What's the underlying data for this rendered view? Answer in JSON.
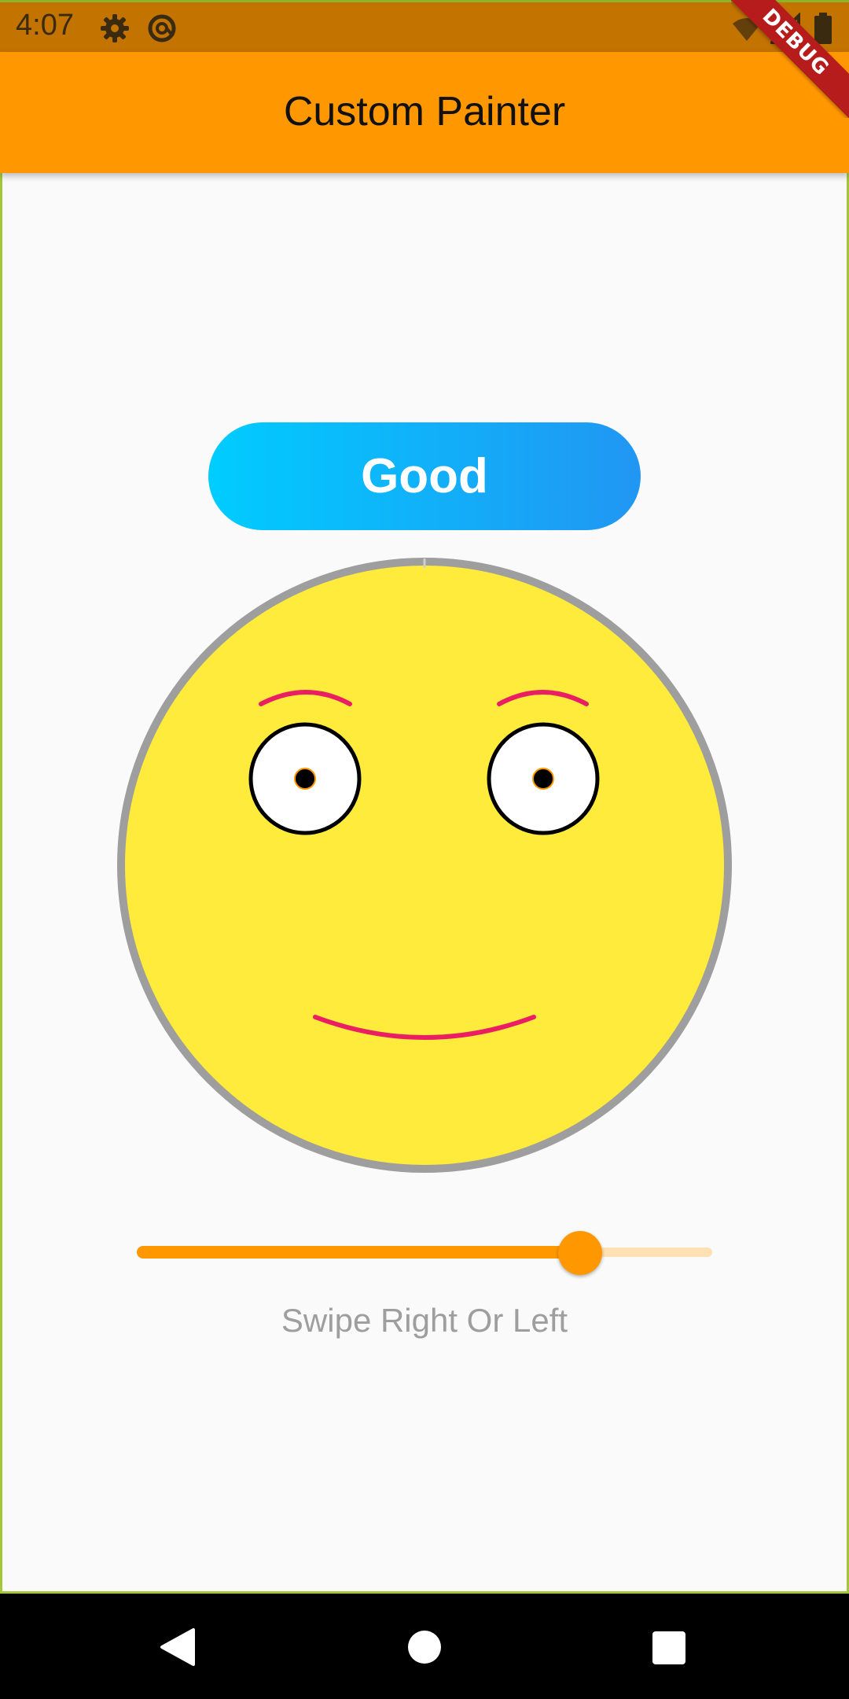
{
  "status_bar": {
    "time": "4:07",
    "icons": [
      "gear-icon",
      "at-sign-icon",
      "wifi-icon",
      "signal-icon",
      "battery-icon"
    ]
  },
  "app_bar": {
    "title": "Custom Painter",
    "color": "#ff9800"
  },
  "debug_banner": {
    "label": "DEBUG"
  },
  "mood": {
    "label": "Good",
    "gradient": [
      "#00ccff",
      "#2196f3"
    ]
  },
  "face": {
    "fill": "#ffeb3b",
    "outline": "#9e9e9e",
    "feature_color": "#e91e63",
    "pupil_color": "#000000",
    "pupil_ring": "#ff9800"
  },
  "slider": {
    "value": 0.77,
    "active_color": "#ff9800",
    "inactive_color": "#ffe0b2"
  },
  "hint": "Swipe Right Or Left",
  "nav_bar": {
    "buttons": [
      "back-icon",
      "home-icon",
      "recents-icon"
    ]
  }
}
